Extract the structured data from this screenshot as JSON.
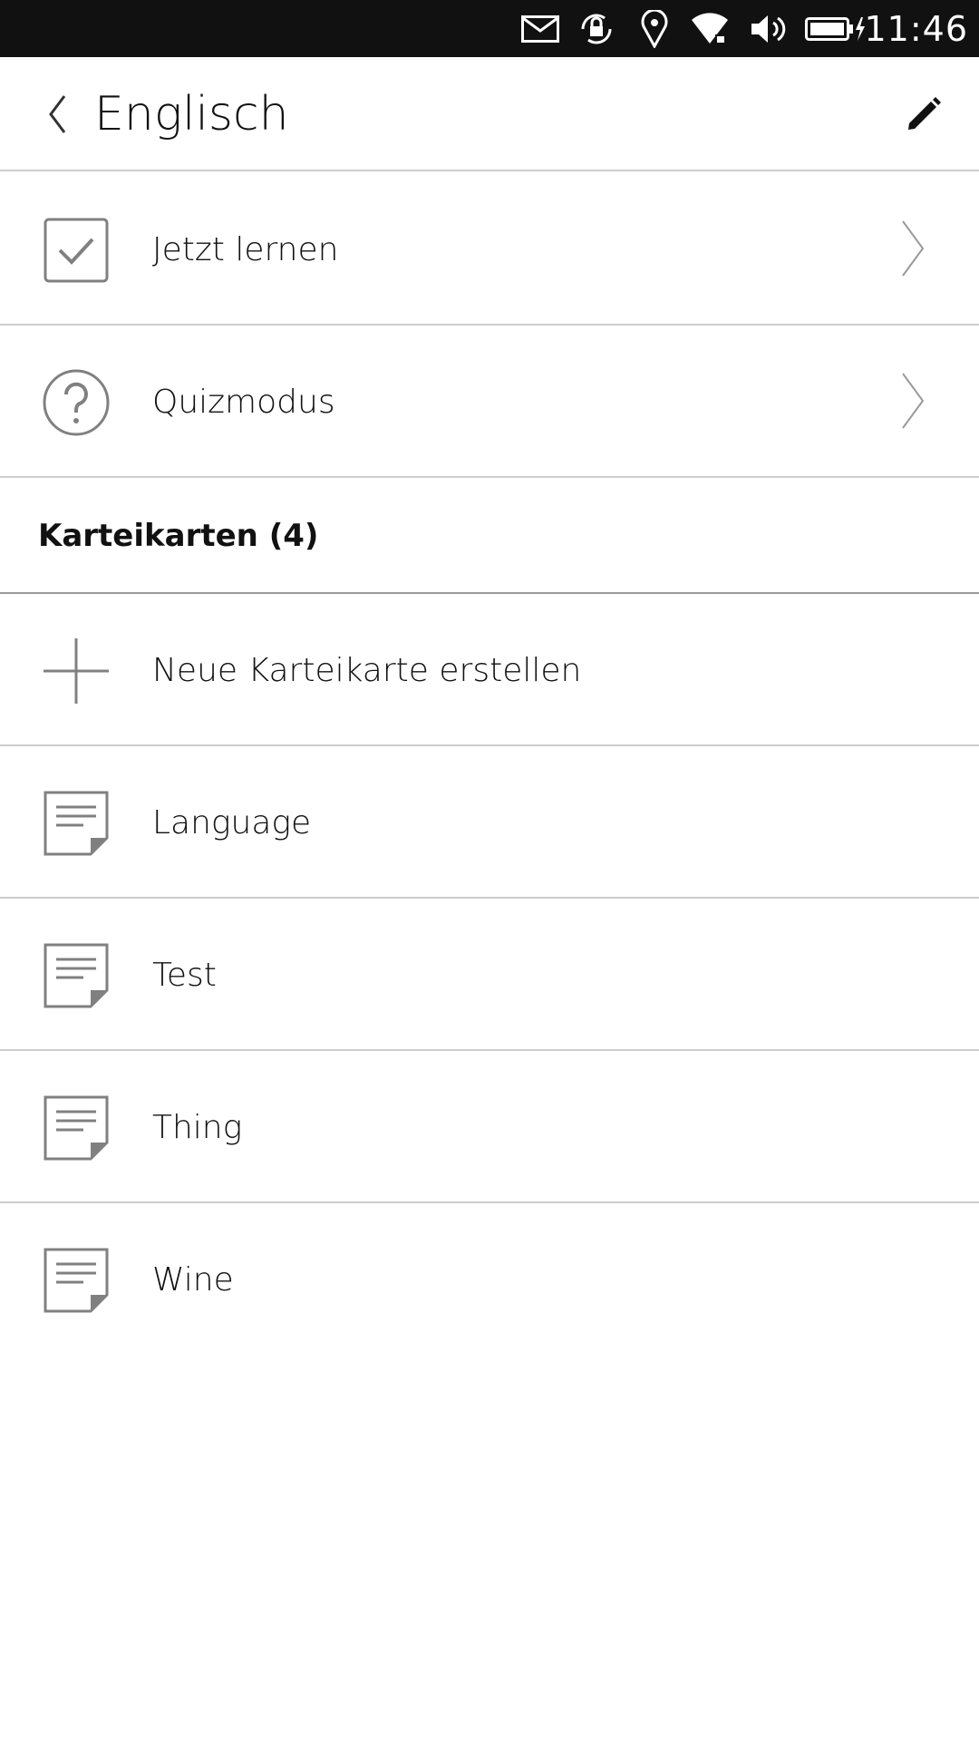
{
  "status_bar": {
    "time": "11:46",
    "icons": [
      "mail-icon",
      "rotation-lock-icon",
      "location-icon",
      "wifi-icon",
      "volume-icon",
      "battery-charging-icon"
    ]
  },
  "header": {
    "title": "Englisch",
    "back_icon": "chevron-left-icon",
    "edit_icon": "pencil-icon"
  },
  "actions": [
    {
      "label": "Jetzt lernen",
      "icon": "checkbox-icon"
    },
    {
      "label": "Quizmodus",
      "icon": "question-icon"
    }
  ],
  "section": {
    "title": "Karteikarten (4)"
  },
  "new_card": {
    "label": "Neue Karteikarte erstellen",
    "icon": "plus-icon"
  },
  "cards": [
    {
      "label": "Language",
      "icon": "note-icon"
    },
    {
      "label": "Test",
      "icon": "note-icon"
    },
    {
      "label": "Thing",
      "icon": "note-icon"
    },
    {
      "label": "Wine",
      "icon": "note-icon"
    }
  ],
  "colors": {
    "status_bar": "#111111",
    "divider": "#cdcdcd",
    "icon": "#808080",
    "text": "#111111"
  }
}
